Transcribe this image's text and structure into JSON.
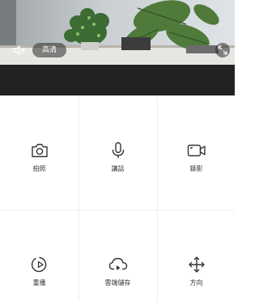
{
  "preview": {
    "quality_label": "高清"
  },
  "controls": {
    "row1": [
      {
        "label": "拍照",
        "icon": "camera-icon"
      },
      {
        "label": "講話",
        "icon": "microphone-icon"
      },
      {
        "label": "錄影",
        "icon": "video-camera-icon"
      }
    ],
    "row2": [
      {
        "label": "重播",
        "icon": "playback-icon"
      },
      {
        "label": "雲端儲存",
        "icon": "cloud-play-icon"
      },
      {
        "label": "方向",
        "icon": "direction-icon"
      }
    ]
  },
  "colors": {
    "dark_strip": "#222222",
    "icon": "#333333",
    "divider": "#efefef"
  }
}
